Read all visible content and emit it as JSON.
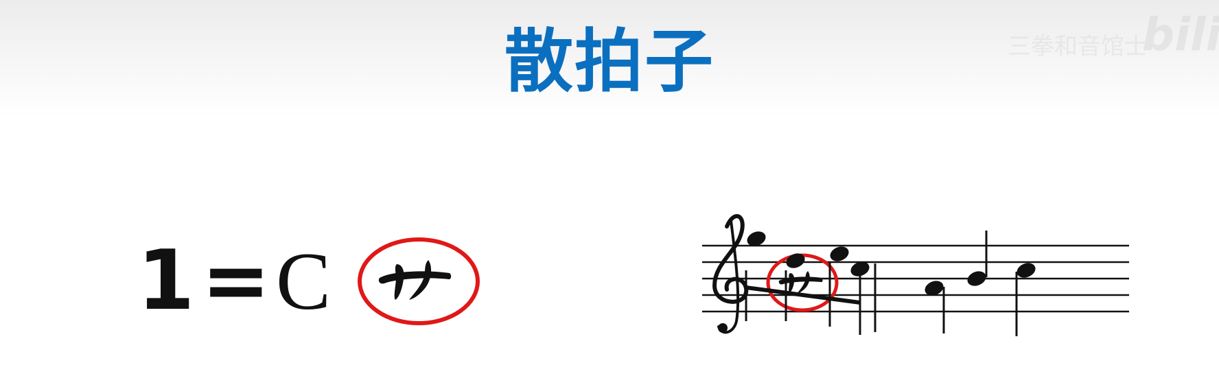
{
  "title": "散拍子",
  "key_signature": {
    "number": "1",
    "equals": "=",
    "note": "C"
  },
  "free_meter_symbol": {
    "icon": "free-meter-symbol-icon",
    "highlight_color": "#e01818"
  },
  "staff": {
    "clef": "treble-clef-icon",
    "meter_icon": "free-meter-symbol-icon",
    "highlight_color": "#e01818"
  },
  "watermark": {
    "text": "三拳和音馆士",
    "logo": "bilibi"
  },
  "colors": {
    "title": "#0b6fc0",
    "highlight": "#e01818"
  }
}
